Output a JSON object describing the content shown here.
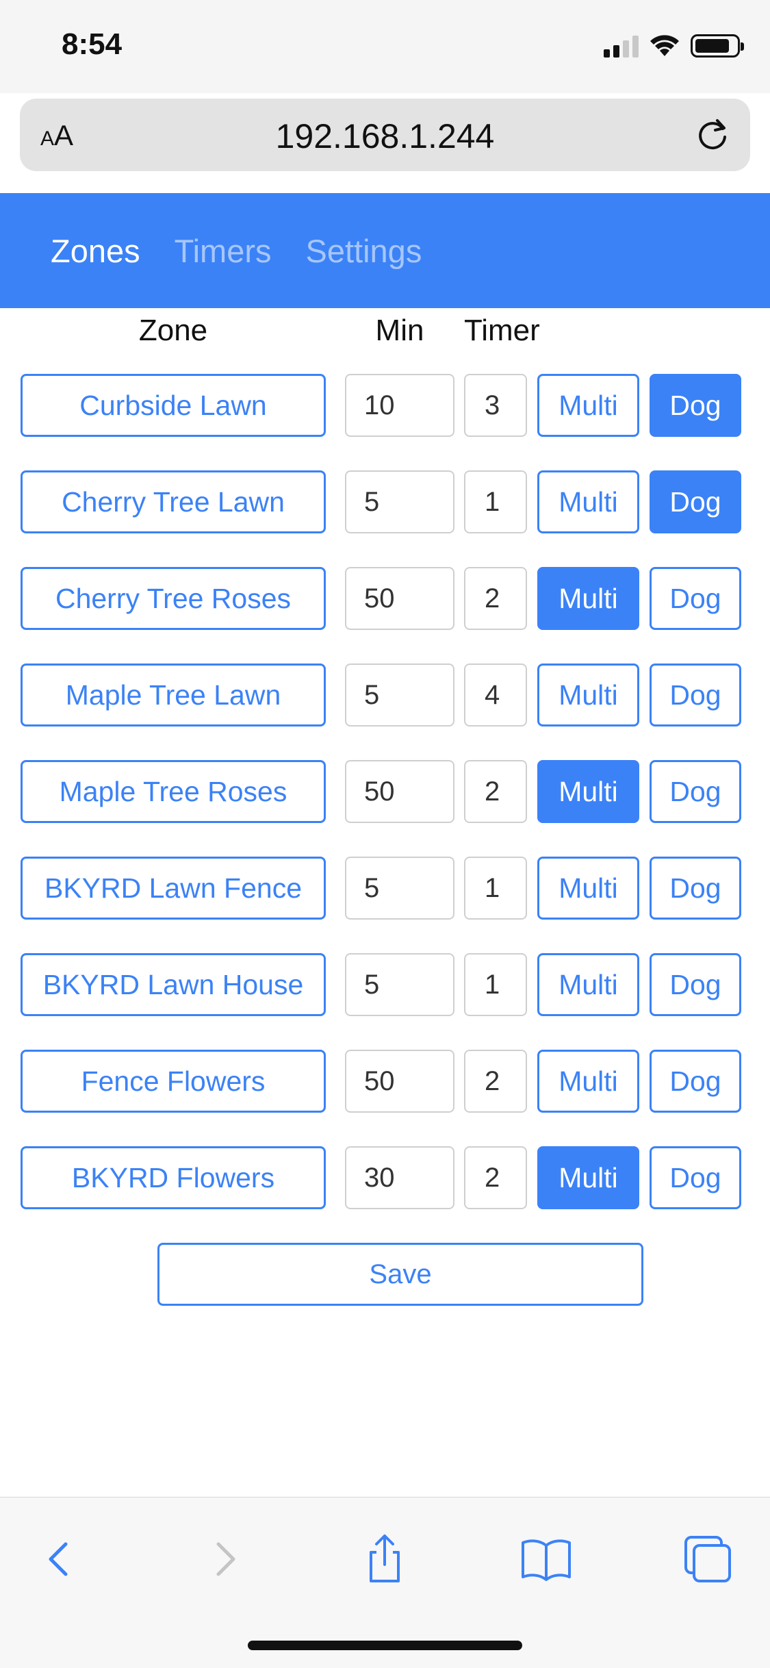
{
  "status_bar": {
    "time": "8:54"
  },
  "browser": {
    "aa_small": "A",
    "aa_large": "A",
    "url": "192.168.1.244"
  },
  "nav": {
    "tabs": [
      {
        "label": "Zones",
        "active": true
      },
      {
        "label": "Timers",
        "active": false
      },
      {
        "label": "Settings",
        "active": false
      }
    ]
  },
  "table": {
    "headers": {
      "zone": "Zone",
      "min": "Min",
      "timer": "Timer"
    },
    "rows": [
      {
        "zone": "Curbside Lawn",
        "min": "10",
        "timer": "3",
        "multi_label": "Multi",
        "multi_on": false,
        "dog_label": "Dog",
        "dog_on": true
      },
      {
        "zone": "Cherry Tree Lawn",
        "min": "5",
        "timer": "1",
        "multi_label": "Multi",
        "multi_on": false,
        "dog_label": "Dog",
        "dog_on": true
      },
      {
        "zone": "Cherry Tree Roses",
        "min": "50",
        "timer": "2",
        "multi_label": "Multi",
        "multi_on": true,
        "dog_label": "Dog",
        "dog_on": false
      },
      {
        "zone": "Maple Tree Lawn",
        "min": "5",
        "timer": "4",
        "multi_label": "Multi",
        "multi_on": false,
        "dog_label": "Dog",
        "dog_on": false
      },
      {
        "zone": "Maple Tree Roses",
        "min": "50",
        "timer": "2",
        "multi_label": "Multi",
        "multi_on": true,
        "dog_label": "Dog",
        "dog_on": false
      },
      {
        "zone": "BKYRD Lawn Fence",
        "min": "5",
        "timer": "1",
        "multi_label": "Multi",
        "multi_on": false,
        "dog_label": "Dog",
        "dog_on": false
      },
      {
        "zone": "BKYRD Lawn House",
        "min": "5",
        "timer": "1",
        "multi_label": "Multi",
        "multi_on": false,
        "dog_label": "Dog",
        "dog_on": false
      },
      {
        "zone": "Fence Flowers",
        "min": "50",
        "timer": "2",
        "multi_label": "Multi",
        "multi_on": false,
        "dog_label": "Dog",
        "dog_on": false
      },
      {
        "zone": "BKYRD Flowers",
        "min": "30",
        "timer": "2",
        "multi_label": "Multi",
        "multi_on": true,
        "dog_label": "Dog",
        "dog_on": false
      }
    ]
  },
  "save_label": "Save",
  "colors": {
    "accent": "#3b82f6",
    "nav_bg": "#3b82f6"
  },
  "toolbar": {
    "icons": [
      "back-icon",
      "forward-icon",
      "share-icon",
      "bookmarks-icon",
      "tabs-icon"
    ]
  }
}
